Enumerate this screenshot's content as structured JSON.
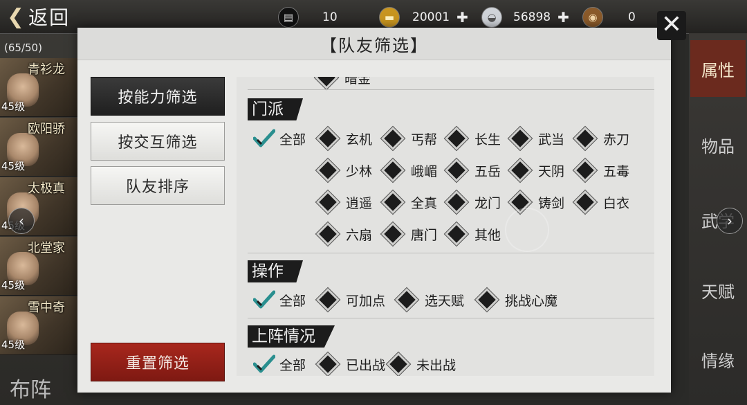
{
  "top": {
    "back_label": "返回",
    "resources": [
      {
        "icon": "cart-icon",
        "value": "10"
      },
      {
        "icon": "gold-bar-icon",
        "value": "20001"
      },
      {
        "icon": "silver-ingot-icon",
        "value": "56898"
      },
      {
        "icon": "coin-icon",
        "value": "0"
      }
    ]
  },
  "team": {
    "count": "(65/50)",
    "heroes": [
      {
        "name": "青衫龙",
        "level": "45级"
      },
      {
        "name": "欧阳骄",
        "level": "45级"
      },
      {
        "name": "太极真",
        "level": "45级"
      },
      {
        "name": "北堂家",
        "level": "45级"
      },
      {
        "name": "雪中奇",
        "level": "45级"
      }
    ],
    "formation_label": "布阵"
  },
  "side_tabs": [
    {
      "label": "属性",
      "active": true
    },
    {
      "label": "物品",
      "active": false
    },
    {
      "label": "武学",
      "active": false
    },
    {
      "label": "天赋",
      "active": false
    },
    {
      "label": "情缘",
      "active": false
    }
  ],
  "modal": {
    "title": "【队友筛选】",
    "left_buttons": [
      {
        "label": "按能力筛选",
        "active": true
      },
      {
        "label": "按交互筛选",
        "active": false
      },
      {
        "label": "队友排序",
        "active": false
      }
    ],
    "reset_label": "重置筛选",
    "partial_top_label": "暗金",
    "sections": {
      "sect": {
        "title": "门派",
        "options": [
          "全部",
          "玄机",
          "丐帮",
          "长生",
          "武当",
          "赤刀",
          "少林",
          "峨嵋",
          "五岳",
          "天阴",
          "五毒",
          "逍遥",
          "全真",
          "龙门",
          "铸剑",
          "白衣",
          "六扇",
          "唐门",
          "其他"
        ]
      },
      "action": {
        "title": "操作",
        "options": [
          "全部",
          "可加点",
          "选天赋",
          "挑战心魔"
        ]
      },
      "deploy": {
        "title": "上阵情况",
        "options": [
          "全部",
          "已出战",
          "未出战"
        ]
      }
    }
  },
  "colors": {
    "reset_button": "#9b2218",
    "active_tab": "#6b2a1e",
    "check_teal": "#2a8f8f"
  }
}
